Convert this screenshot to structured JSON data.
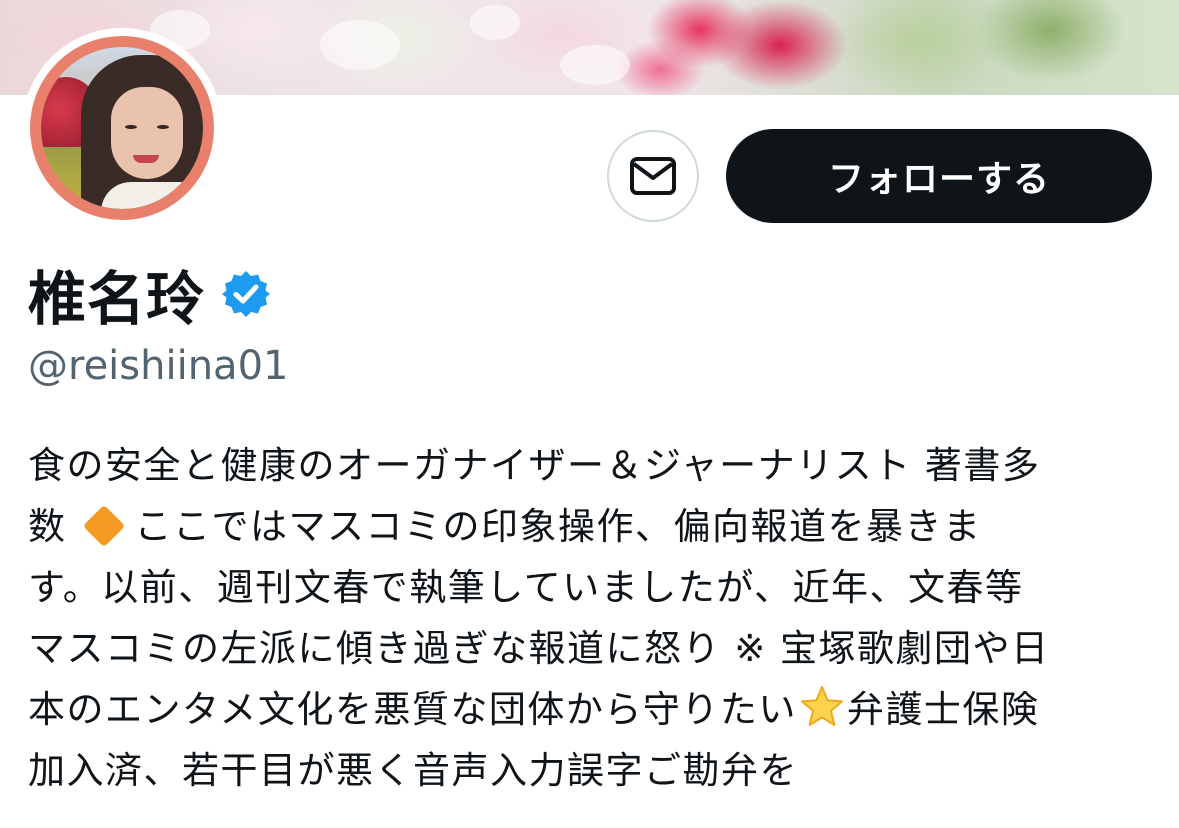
{
  "profile": {
    "display_name": "椎名玲",
    "handle": "@reishiina01",
    "verified": true
  },
  "actions": {
    "message_icon": "envelope-icon",
    "follow_label": "フォローする"
  },
  "bio": {
    "line1": "食の安全と健康のオーガナイザー＆ジャーナリスト 著書多",
    "line2_a": "数",
    "line2_emoji": "large-orange-diamond-emoji",
    "line2_b": "ここではマスコミの印象操作、偏向報道を暴きま",
    "line3": "す。以前、週刊文春で執筆していましたが、近年、文春等",
    "line4": "マスコミの左派に傾き過ぎな報道に怒り ※ 宝塚歌劇団や日",
    "line5_a": "本のエンタメ文化を悪質な団体から守りたい",
    "line5_emoji": "star-emoji",
    "line5_b": "弁護士保険",
    "line6": "加入済、若干目が悪く音声入力誤字ご勘弁を"
  },
  "colors": {
    "follow_bg": "#0f1419",
    "verified_blue": "#1d9bf0",
    "handle_gray": "#536471",
    "avatar_ring": "#e9806b"
  }
}
